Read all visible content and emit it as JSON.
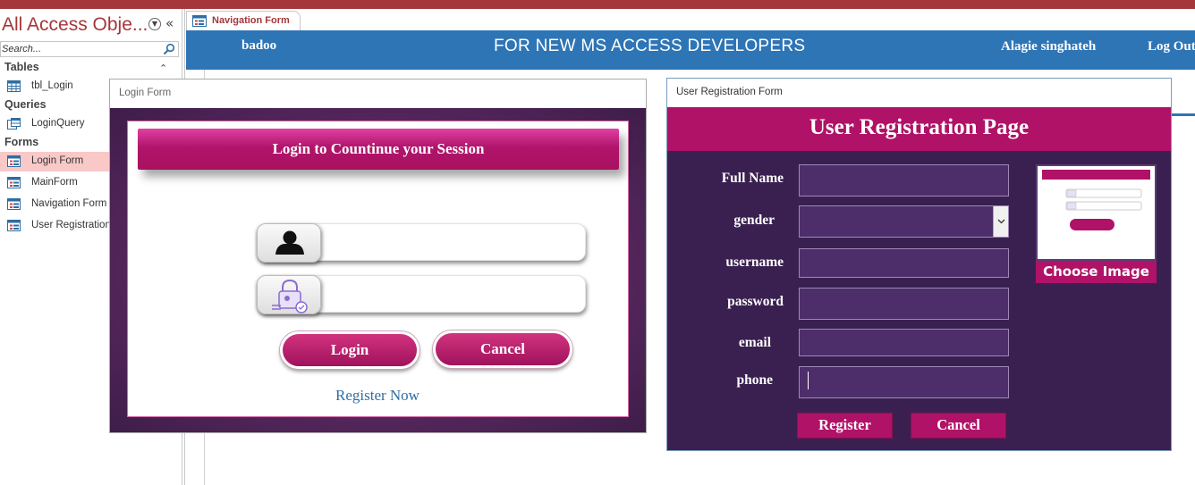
{
  "nav": {
    "title": "All Access Obje...",
    "search_placeholder": "Search...",
    "groups": {
      "tables": "Tables",
      "queries": "Queries",
      "forms": "Forms"
    },
    "tables": [
      "tbl_Login"
    ],
    "queries": [
      "LoginQuery"
    ],
    "forms": [
      "Login Form",
      "MainForm",
      "Navigation Form",
      "User Registration"
    ],
    "selected_item": "Login Form"
  },
  "tab": {
    "label": "Navigation Form"
  },
  "header": {
    "user_short": "badoo",
    "title": "FOR NEW MS ACCESS DEVELOPERS",
    "user_name": "Alagie singhateh",
    "logout": "Log Out"
  },
  "login_form": {
    "window_title": "Login Form",
    "heading": "Login to Countinue your Session",
    "username_value": "",
    "password_value": "",
    "login_button": "Login",
    "cancel_button": "Cancel",
    "register_link": "Register Now"
  },
  "registration_form": {
    "window_title": "User Registration Form",
    "heading": "User Registration Page",
    "labels": {
      "full_name": "Full Name",
      "gender": "gender",
      "username": "username",
      "password": "password",
      "email": "email",
      "phone": "phone"
    },
    "choose_image": "Choose Image",
    "register_button": "Register",
    "cancel_button": "Cancel"
  },
  "colors": {
    "access_accent": "#a4373a",
    "header_blue": "#2e75b6",
    "magenta": "#b01267",
    "purple_dark": "#3a2050"
  }
}
